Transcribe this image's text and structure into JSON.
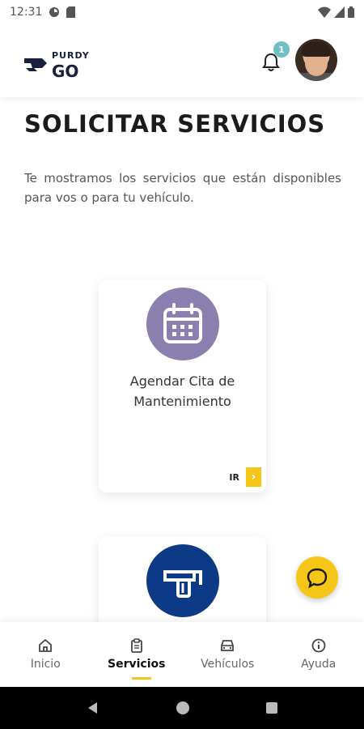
{
  "status_bar": {
    "time": "12:31"
  },
  "header": {
    "logo_top": "PURDY",
    "logo_bottom": "GO",
    "notification_count": "1"
  },
  "page": {
    "title": "SOLICITAR SERVICIOS",
    "description": "Te mostramos los servicios que están disponibles para vos o para tu vehículo."
  },
  "services": [
    {
      "title_line1": "Agendar Cita de",
      "title_line2": "Mantenimiento",
      "go_label": "IR",
      "icon": "calendar-icon",
      "color": "#8a7fae"
    },
    {
      "icon": "fuel-pump-icon",
      "color": "#0c3a86"
    }
  ],
  "bottom_nav": [
    {
      "label": "Inicio",
      "icon": "home-icon",
      "active": false
    },
    {
      "label": "Servicios",
      "icon": "clipboard-icon",
      "active": true
    },
    {
      "label": "Vehículos",
      "icon": "car-icon",
      "active": false
    },
    {
      "label": "Ayuda",
      "icon": "info-icon",
      "active": false
    }
  ],
  "colors": {
    "accent": "#f5c518",
    "badge": "#6fbfc6",
    "brand_dark": "#1a1f3d"
  }
}
